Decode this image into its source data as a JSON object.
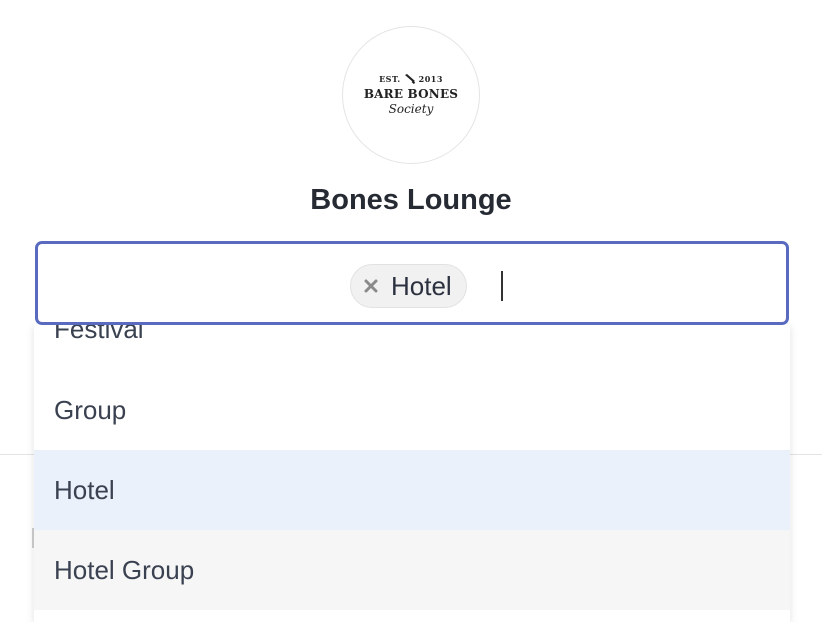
{
  "logo": {
    "est": "EST.",
    "year": "2013",
    "name": "BARE BONES",
    "society": "Society"
  },
  "venue": {
    "title": "Bones Lounge"
  },
  "select": {
    "chips": [
      {
        "label": "Hotel"
      }
    ]
  },
  "dropdown": {
    "options": [
      {
        "label": "Festival"
      },
      {
        "label": "Group"
      },
      {
        "label": "Hotel",
        "state": "selected"
      },
      {
        "label": "Hotel Group",
        "state": "hovered"
      }
    ]
  },
  "colors": {
    "focus_border": "#5a6bbf",
    "selected_bg": "#ebf1fb",
    "hover_bg": "#f6f6f6",
    "chip_bg": "#f1f1f1"
  }
}
